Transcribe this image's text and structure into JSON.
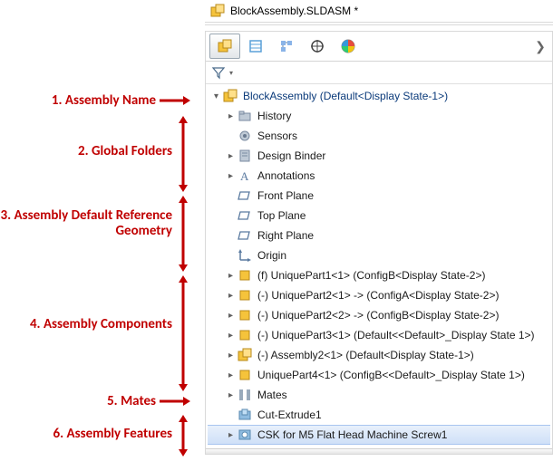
{
  "title": "BlockAssembly.SLDASM *",
  "labels": {
    "l1": "1. Assembly Name",
    "l2": "2. Global Folders",
    "l3": "3. Assembly Default Reference Geometry",
    "l4": "4. Assembly Components",
    "l5": "5. Mates",
    "l6": "6. Assembly Features"
  },
  "root": "BlockAssembly  (Default<Display State-1>)",
  "nodes": {
    "history": "History",
    "sensors": "Sensors",
    "designBinder": "Design Binder",
    "annotations": "Annotations",
    "frontPlane": "Front Plane",
    "topPlane": "Top Plane",
    "rightPlane": "Right Plane",
    "origin": "Origin",
    "c1": "(f) UniquePart1<1>  (ConfigB<Display State-2>)",
    "c2": "(-) UniquePart2<1> ->  (ConfigA<Display State-2>)",
    "c3": "(-) UniquePart2<2> ->  (ConfigB<Display State-2>)",
    "c4": "(-) UniquePart3<1>  (Default<<Default>_Display State 1>)",
    "c5": "(-) Assembly2<1>  (Default<Display State-1>)",
    "c6": "UniquePart4<1>  (ConfigB<<Default>_Display State 1>)",
    "mates": "Mates",
    "cut": "Cut-Extrude1",
    "csk": "CSK for M5 Flat Head Machine Screw1"
  }
}
